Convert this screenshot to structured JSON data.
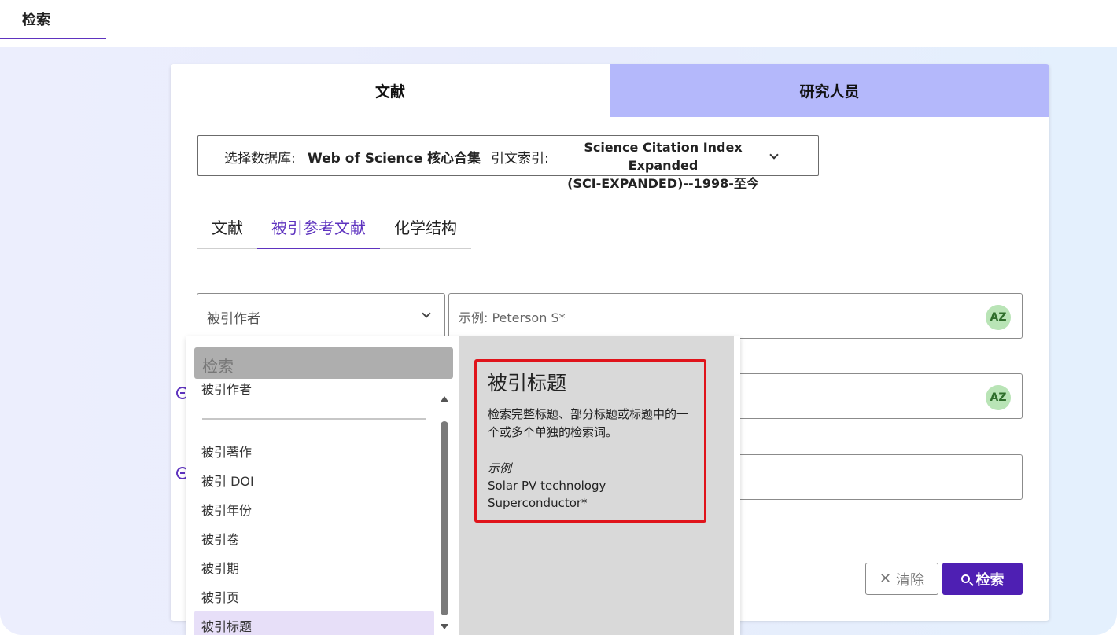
{
  "top_nav": {
    "tab": "检索"
  },
  "main_tabs": [
    {
      "label": "文献"
    },
    {
      "label": "研究人员"
    }
  ],
  "database": {
    "label": "选择数据库:",
    "value": "Web of Science 核心合集",
    "index_label": "引文索引:",
    "index_value_line1": "Science Citation Index Expanded",
    "index_value_line2": "(SCI-EXPANDED)--1998-至今"
  },
  "sub_tabs": [
    {
      "label": "文献"
    },
    {
      "label": "被引参考文献"
    },
    {
      "label": "化学结构"
    }
  ],
  "field_select": {
    "value": "被引作者"
  },
  "query_rows": [
    {
      "placeholder": "示例: Peterson S*",
      "az": "AZ"
    },
    {
      "placeholder": "",
      "az": "AZ"
    },
    {
      "placeholder": ""
    }
  ],
  "buttons": {
    "clear": "清除",
    "search": "检索",
    "clear_icon": "✕"
  },
  "dropdown": {
    "search_placeholder": "检索",
    "items": [
      "被引作者",
      "被引著作",
      "被引 DOI",
      "被引年份",
      "被引卷",
      "被引期",
      "被引页",
      "被引标题"
    ],
    "selected": "被引标题"
  },
  "help": {
    "title": "被引标题",
    "description": "检索完整标题、部分标题或标题中的一个或多个单独的检索词。",
    "example_label": "示例",
    "examples": [
      "Solar PV technology",
      "Superconductor*"
    ]
  },
  "colors": {
    "accent": "#5e33bf",
    "primary_button": "#4e1fb3",
    "inactive_tab": "#b4b8fb",
    "highlight_border": "#e0141b"
  }
}
